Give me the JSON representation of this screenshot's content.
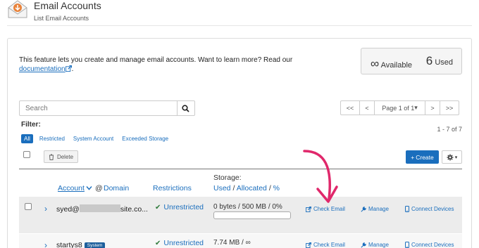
{
  "header": {
    "title": "Email Accounts",
    "subtitle": "List Email Accounts",
    "icon": "email-accounts-icon"
  },
  "intro": {
    "text": "This feature lets you create and manage email accounts. Want to learn more? Read our",
    "link": "documentation",
    "suffix": "."
  },
  "stats": {
    "available_symbol": "∞",
    "available_label": "Available",
    "used_count": "6",
    "used_label": "Used"
  },
  "search": {
    "placeholder": "Search"
  },
  "pagination": {
    "first": "<<",
    "prev": "<",
    "current": "Page 1 of 1",
    "next": ">",
    "last": ">>",
    "range": "1 - 7 of 7"
  },
  "filter": {
    "label": "Filter:",
    "options": [
      "All",
      "Restricted",
      "System Account",
      "Exceeded Storage"
    ],
    "active": "All"
  },
  "toolbar": {
    "delete_label": "Delete",
    "create_label": "Create"
  },
  "columns": {
    "account": "Account",
    "at": "@",
    "domain": "Domain",
    "restrictions": "Restrictions",
    "storage_title": "Storage:",
    "used": "Used",
    "slash": "/",
    "allocated": "Allocated",
    "percent": "%"
  },
  "rows": [
    {
      "account_prefix": "syed@",
      "account_suffix": "site.co...",
      "restriction": "Unrestricted",
      "storage": "0 bytes / 500 MB / 0%",
      "storage_fraction": 0,
      "actions": [
        "Check Email",
        "Manage",
        "Connect Devices"
      ]
    },
    {
      "account_prefix": "startys8",
      "badge": "System",
      "restriction": "Unrestricted",
      "storage": "7.74 MB / ∞",
      "actions": [
        "Check Email",
        "Manage",
        "Connect Devices"
      ]
    }
  ],
  "colors": {
    "accent": "#1a6ebd",
    "success": "#2d7a3a",
    "annotation_arrow": "#e0286b"
  }
}
